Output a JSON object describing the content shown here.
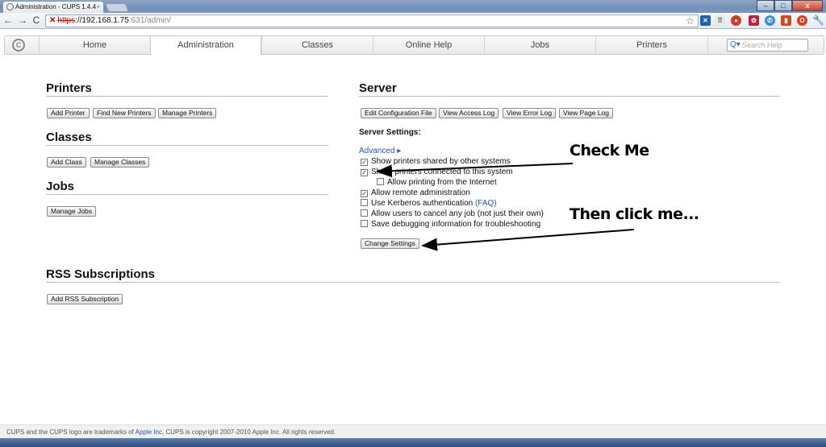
{
  "browser": {
    "tab_title": "Administration - CUPS 1.4.4",
    "tab_close": "×",
    "url_scheme": "https",
    "url_host": "://192.168.1.75",
    "url_path": ":631/admin/",
    "win_minimize": "–",
    "win_maximize": "□",
    "win_close": "x"
  },
  "nav": {
    "tabs": [
      "Home",
      "Administration",
      "Classes",
      "Online Help",
      "Jobs",
      "Printers"
    ],
    "active": "Administration",
    "search_placeholder": "Search Help"
  },
  "printers": {
    "heading": "Printers",
    "buttons": [
      "Add Printer",
      "Find New Printers",
      "Manage Printers"
    ]
  },
  "classes": {
    "heading": "Classes",
    "buttons": [
      "Add Class",
      "Manage Classes"
    ]
  },
  "jobs": {
    "heading": "Jobs",
    "buttons": [
      "Manage Jobs"
    ]
  },
  "server": {
    "heading": "Server",
    "buttons": [
      "Edit Configuration File",
      "View Access Log",
      "View Error Log",
      "View Page Log"
    ],
    "settings_label": "Server Settings:",
    "advanced_link": "Advanced ▸",
    "options": [
      {
        "label": "Show printers shared by other systems",
        "checked": true
      },
      {
        "label": "Share printers connected to this system",
        "checked": true
      },
      {
        "label": "Allow printing from the Internet",
        "checked": false
      },
      {
        "label": "Allow remote administration",
        "checked": true
      },
      {
        "label": "Use Kerberos authentication",
        "checked": false,
        "link": "(FAQ)"
      },
      {
        "label": "Allow users to cancel any job (not just their own)",
        "checked": false
      },
      {
        "label": "Save debugging information for troubleshooting",
        "checked": false
      }
    ],
    "change_button": "Change Settings"
  },
  "rss": {
    "heading": "RSS Subscriptions",
    "button": "Add RSS Subscription"
  },
  "annotations": {
    "check_me": "Check Me",
    "then_click": "Then click me..."
  },
  "footer": {
    "text_before": "CUPS and the CUPS logo are trademarks of ",
    "apple_link": "Apple Inc.",
    "text_after": " CUPS is copyright 2007-2010 Apple Inc. All rights reserved."
  }
}
